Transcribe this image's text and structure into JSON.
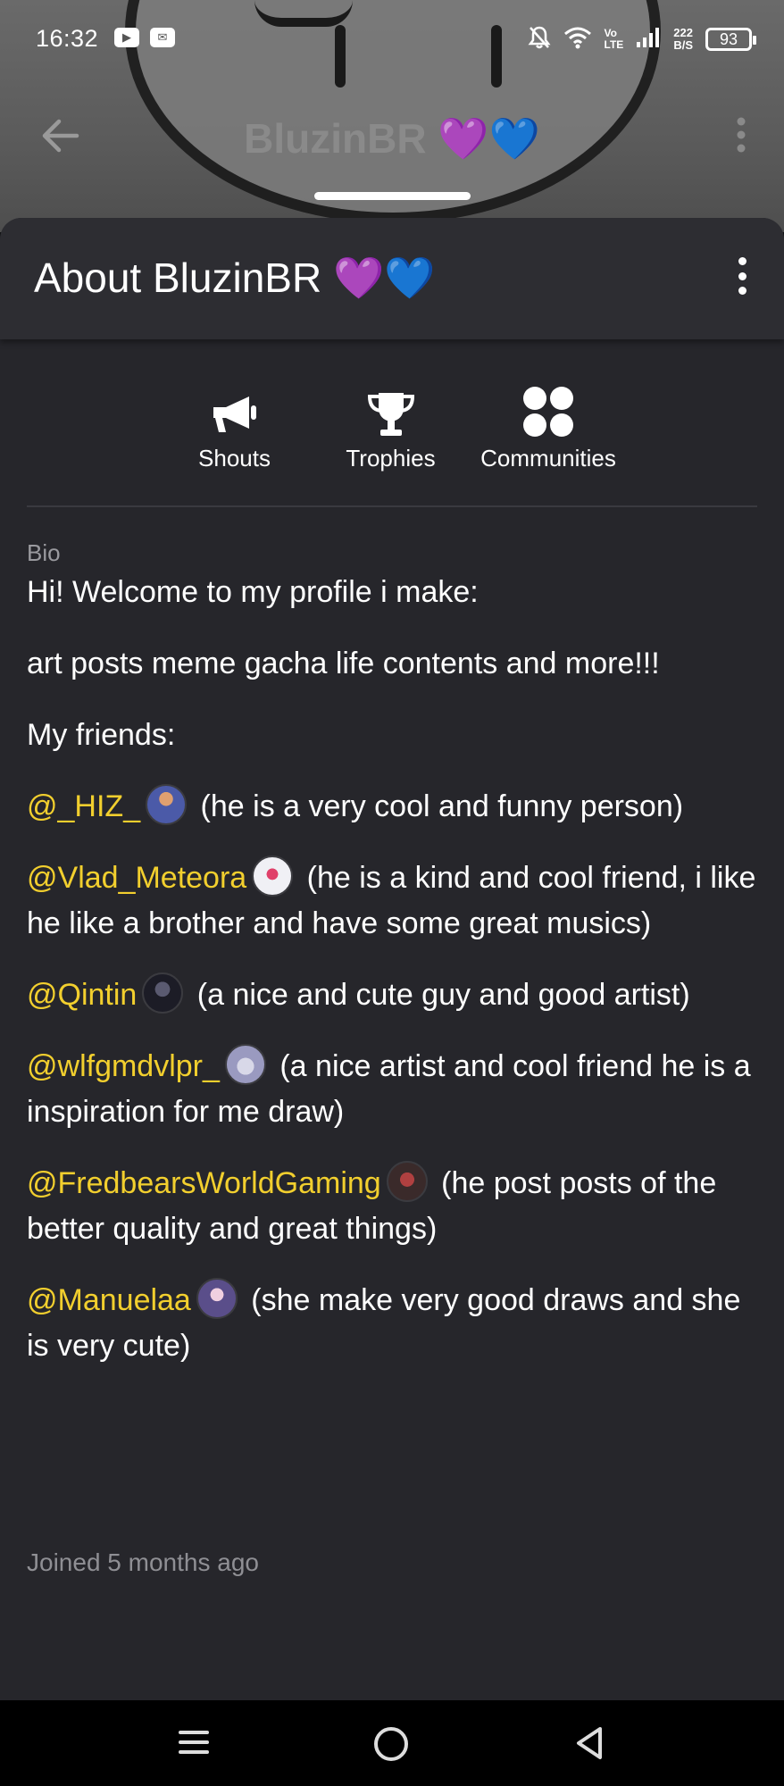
{
  "status_bar": {
    "time": "16:32",
    "volte_top": "Vo",
    "volte_bottom": "LTE",
    "net_speed_value": "222",
    "net_speed_unit": "B/S",
    "battery": "93"
  },
  "top_nav": {
    "title": "BluzinBR 💜💙"
  },
  "sheet": {
    "title": "About BluzinBR 💜💙"
  },
  "actions": [
    {
      "label": "Shouts",
      "icon": "megaphone-icon"
    },
    {
      "label": "Trophies",
      "icon": "trophy-icon"
    },
    {
      "label": "Communities",
      "icon": "communities-icon"
    }
  ],
  "bio": {
    "label": "Bio",
    "line1": "Hi! Welcome to my profile i make:",
    "line2": "art posts meme gacha life contents and more!!!",
    "line3": "My friends:",
    "friends": [
      {
        "handle": "@_HIZ_",
        "text": " (he is a very cool and funny person)",
        "avatar_color": "#4b5aa8"
      },
      {
        "handle": "@Vlad_Meteora",
        "text": "  (he is a kind and cool friend, i like he like a brother and have some great musics)",
        "avatar_color": "#d9d9e6"
      },
      {
        "handle": "@Qintin",
        "text": " (a nice and cute guy and good artist)",
        "avatar_color": "#2c2c3a"
      },
      {
        "handle": "@wlfgmdvlpr_",
        "text": " (a nice artist and cool friend he is a inspiration for me draw)",
        "avatar_color": "#a9a9c8"
      },
      {
        "handle": "@FredbearsWorldGaming",
        "text": " (he post posts of the better quality and great things)",
        "avatar_color": "#7a2b2b"
      },
      {
        "handle": "@Manuelaa",
        "text": " (she make very good draws and she is very cute)",
        "avatar_color": "#5a4e8a"
      }
    ]
  },
  "joined": "Joined 5 months ago",
  "colors": {
    "mention": "#f2cf2e",
    "sheet_bg": "#26262b",
    "header_bg": "#2d2d32"
  }
}
